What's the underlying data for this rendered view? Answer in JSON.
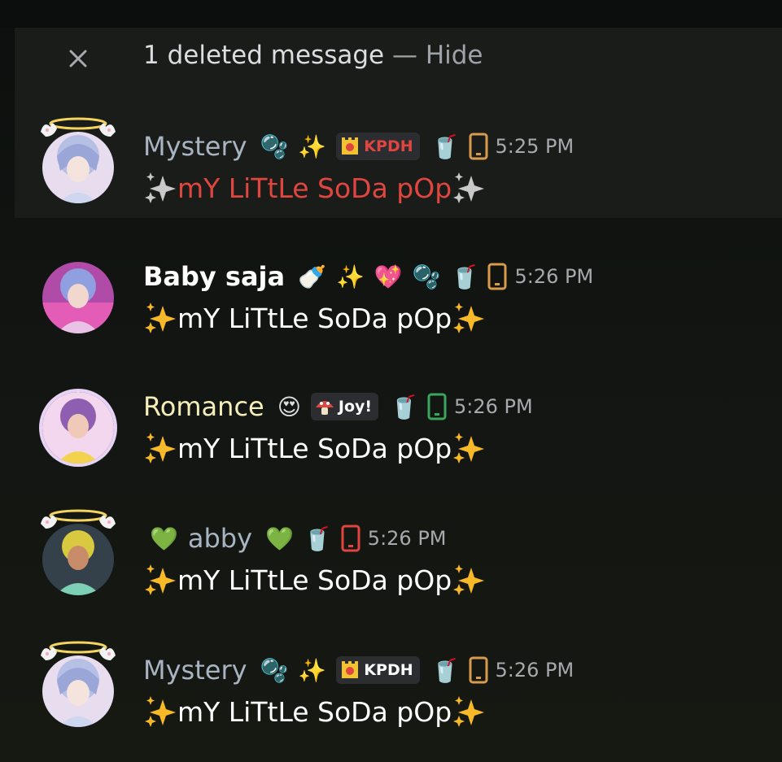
{
  "deleted": {
    "text": "1 deleted message",
    "separator": " — ",
    "hide_label": "Hide"
  },
  "messages": [
    {
      "username": "Mystery",
      "name_color": "#a9b4c2",
      "badges_before": [
        "🫧",
        "✨"
      ],
      "tag": {
        "label": "KPDH",
        "color": "#e0463f"
      },
      "badges_after": [
        "🥤"
      ],
      "device_color": "#d99b4b",
      "time": "5:25 PM",
      "text": "mY LiTtLe SoDa pOp",
      "text_color": "#e0463f",
      "sparkle": "gray"
    },
    {
      "username": "Baby saja",
      "name_color": "#ffffff",
      "badges_before": [
        "🍼",
        "✨",
        "💖",
        "🫧"
      ],
      "tag": null,
      "badges_after": [
        "🥤"
      ],
      "device_color": "#d99b4b",
      "time": "5:26 PM",
      "text": "mY LiTtLe SoDa pOp",
      "text_color": "#ffffff",
      "sparkle": "gold"
    },
    {
      "username": "Romance",
      "name_color": "#f5eeb8",
      "badges_before": [
        "😍"
      ],
      "tag": {
        "label": "Joy!",
        "color": "#ffffff"
      },
      "badges_after": [
        "🥤"
      ],
      "device_color": "#3ba55d",
      "time": "5:26 PM",
      "text": "mY LiTtLe SoDa pOp",
      "text_color": "#ffffff",
      "sparkle": "gold"
    },
    {
      "username": "abby",
      "name_color": "#a9b4c2",
      "badges_before": [
        "💚"
      ],
      "badges_name_after": [
        "💚"
      ],
      "tag": null,
      "badges_after": [
        "🥤"
      ],
      "device_color": "#e0463f",
      "time": "5:26 PM",
      "text": "mY LiTtLe SoDa pOp",
      "text_color": "#ffffff",
      "sparkle": "gold"
    },
    {
      "username": "Mystery",
      "name_color": "#a9b4c2",
      "badges_before": [
        "🫧",
        "✨"
      ],
      "tag": {
        "label": "KPDH",
        "color": "#ffffff"
      },
      "badges_after": [
        "🥤"
      ],
      "device_color": "#d99b4b",
      "time": "5:26 PM",
      "text": "mY LiTtLe SoDa pOp",
      "text_color": "#ffffff",
      "sparkle": "gold"
    }
  ]
}
